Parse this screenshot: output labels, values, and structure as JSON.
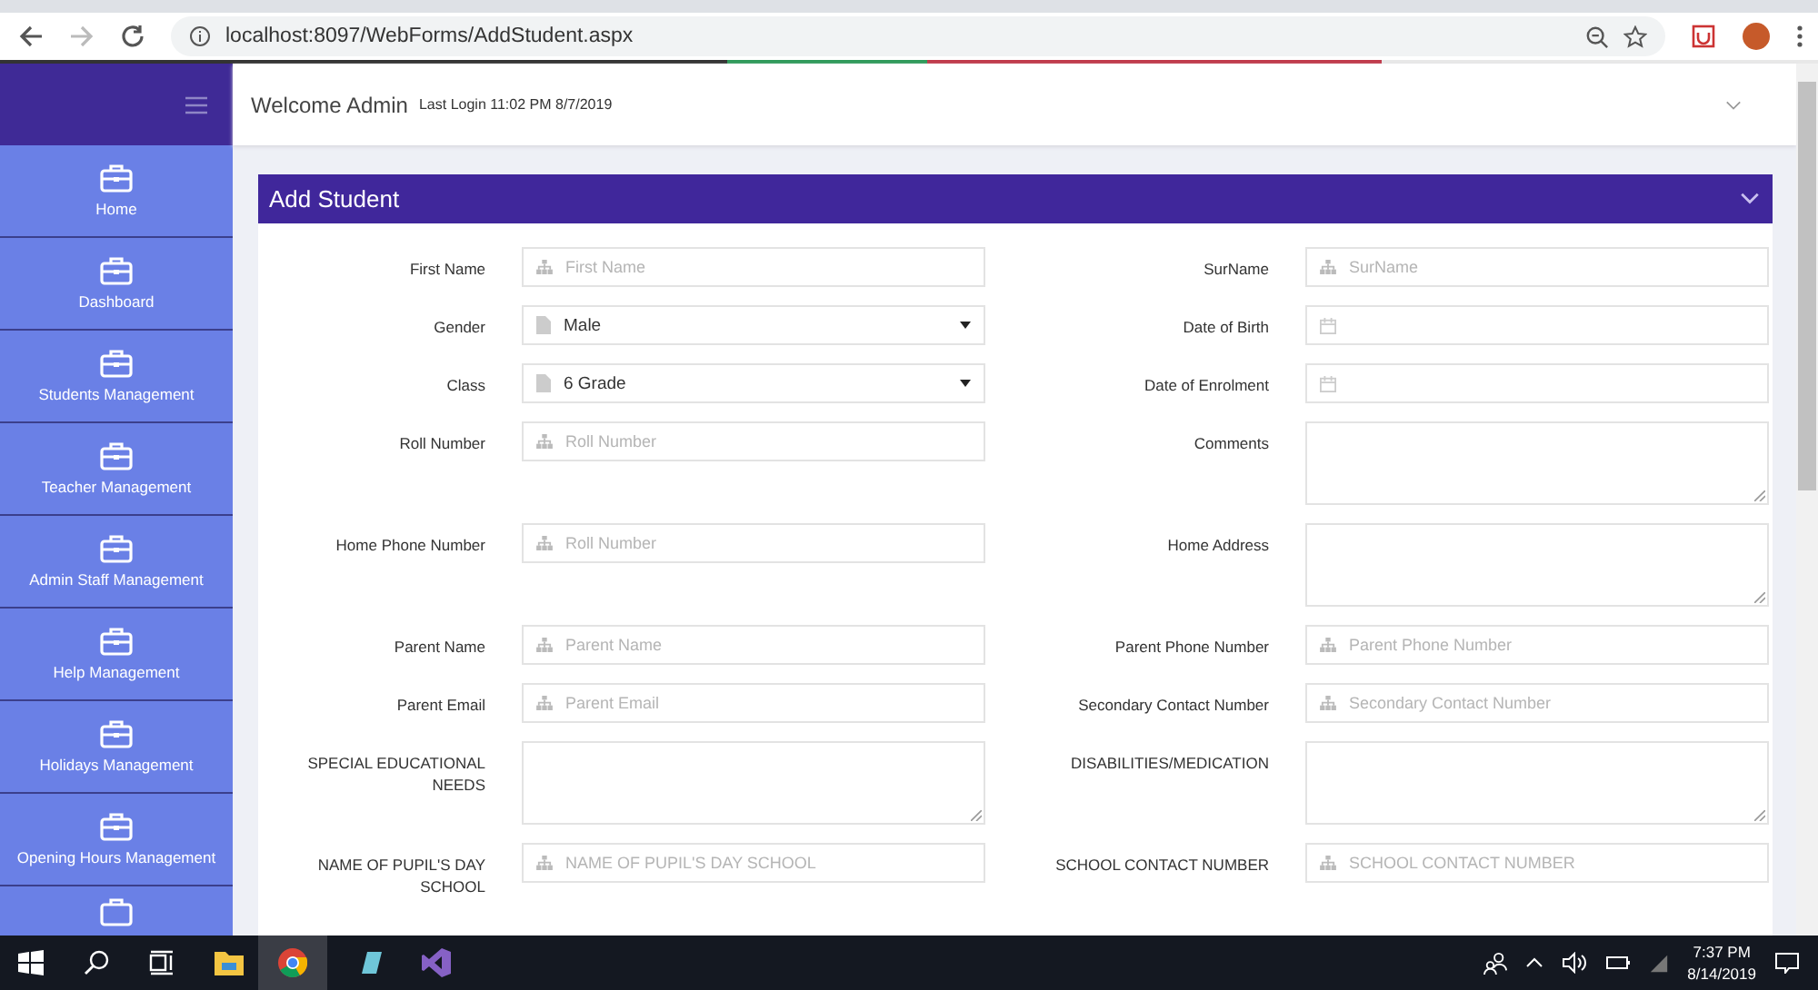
{
  "browser": {
    "url": "localhost:8097/WebForms/AddStudent.aspx"
  },
  "sidebar": {
    "items": [
      {
        "label": "Home"
      },
      {
        "label": "Dashboard"
      },
      {
        "label": "Students Management"
      },
      {
        "label": "Teacher Management"
      },
      {
        "label": "Admin Staff Management"
      },
      {
        "label": "Help Management"
      },
      {
        "label": "Holidays Management"
      },
      {
        "label": "Opening Hours Management"
      }
    ]
  },
  "header": {
    "welcome": "Welcome Admin",
    "last_login": "Last Login 11:02 PM 8/7/2019"
  },
  "panel": {
    "title": "Add Student"
  },
  "form_rows": [
    {
      "fields": [
        {
          "label": "First Name",
          "kind": "text",
          "placeholder": "First Name"
        },
        {
          "label": "SurName",
          "kind": "text",
          "placeholder": "SurName"
        }
      ]
    },
    {
      "fields": [
        {
          "label": "Gender",
          "kind": "select",
          "value": "Male"
        },
        {
          "label": "Date of Birth",
          "kind": "date"
        }
      ]
    },
    {
      "fields": [
        {
          "label": "Class",
          "kind": "select",
          "value": "6 Grade"
        },
        {
          "label": "Date of Enrolment",
          "kind": "date"
        }
      ]
    },
    {
      "fields": [
        {
          "label": "Roll Number",
          "kind": "text",
          "placeholder": "Roll Number"
        },
        {
          "label": "Comments",
          "kind": "textarea"
        }
      ]
    },
    {
      "fields": [
        {
          "label": "Home Phone Number",
          "kind": "text",
          "placeholder": "Roll Number"
        },
        {
          "label": "Home Address",
          "kind": "textarea"
        }
      ]
    },
    {
      "fields": [
        {
          "label": "Parent Name",
          "kind": "text",
          "placeholder": "Parent Name"
        },
        {
          "label": "Parent Phone Number",
          "kind": "text",
          "placeholder": "Parent Phone Number"
        }
      ]
    },
    {
      "fields": [
        {
          "label": "Parent Email",
          "kind": "text",
          "placeholder": "Parent Email"
        },
        {
          "label": "Secondary Contact Number",
          "kind": "text",
          "placeholder": "Secondary Contact Number"
        }
      ]
    },
    {
      "fields": [
        {
          "label": "SPECIAL EDUCATIONAL NEEDS",
          "kind": "textarea"
        },
        {
          "label": "DISABILITIES/MEDICATION",
          "kind": "textarea"
        }
      ]
    },
    {
      "fields": [
        {
          "label": "NAME OF PUPIL'S DAY SCHOOL",
          "kind": "text",
          "placeholder": "NAME OF PUPIL'S DAY SCHOOL"
        },
        {
          "label": "SCHOOL CONTACT NUMBER",
          "kind": "text",
          "placeholder": "SCHOOL CONTACT NUMBER"
        }
      ]
    }
  ],
  "taskbar": {
    "time": "7:37 PM",
    "date": "8/14/2019"
  }
}
